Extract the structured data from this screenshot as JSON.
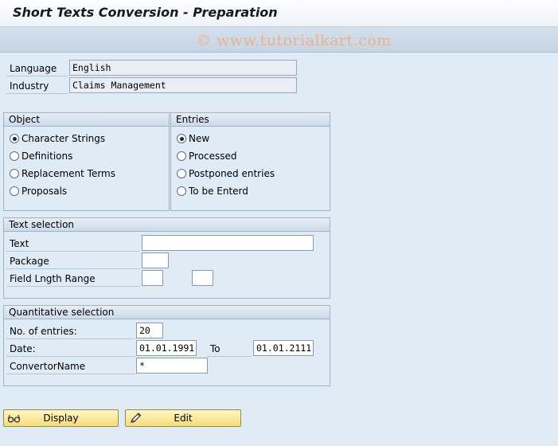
{
  "title": "Short Texts Conversion - Preparation",
  "watermark": "© www.tutorialkart.com",
  "header": {
    "language_label": "Language",
    "language_value": "English",
    "industry_label": "Industry",
    "industry_value": "Claims Management"
  },
  "object_group": {
    "title": "Object",
    "options": [
      {
        "label": "Character Strings",
        "selected": true
      },
      {
        "label": "Definitions",
        "selected": false
      },
      {
        "label": "Replacement Terms",
        "selected": false
      },
      {
        "label": "Proposals",
        "selected": false
      }
    ]
  },
  "entries_group": {
    "title": "Entries",
    "options": [
      {
        "label": "New",
        "selected": true
      },
      {
        "label": "Processed",
        "selected": false
      },
      {
        "label": "Postponed entries",
        "selected": false
      },
      {
        "label": "To be Enterd",
        "selected": false
      }
    ]
  },
  "text_selection": {
    "title": "Text selection",
    "text_label": "Text",
    "text_value": "",
    "package_label": "Package",
    "package_value": "",
    "range_label": "Field Lngth Range",
    "range_from": "",
    "range_to": ""
  },
  "quant_selection": {
    "title": "Quantitative selection",
    "entries_label": "No. of entries:",
    "entries_value": "20",
    "date_label": "Date:",
    "date_from": "01.01.1991",
    "to_label": "To",
    "date_to": "01.01.2111",
    "convertor_label": "ConvertorName",
    "convertor_value": "*"
  },
  "buttons": {
    "display_label": "Display",
    "edit_label": "Edit"
  },
  "icons": {
    "display": "glasses-icon",
    "edit": "pencil-icon"
  }
}
